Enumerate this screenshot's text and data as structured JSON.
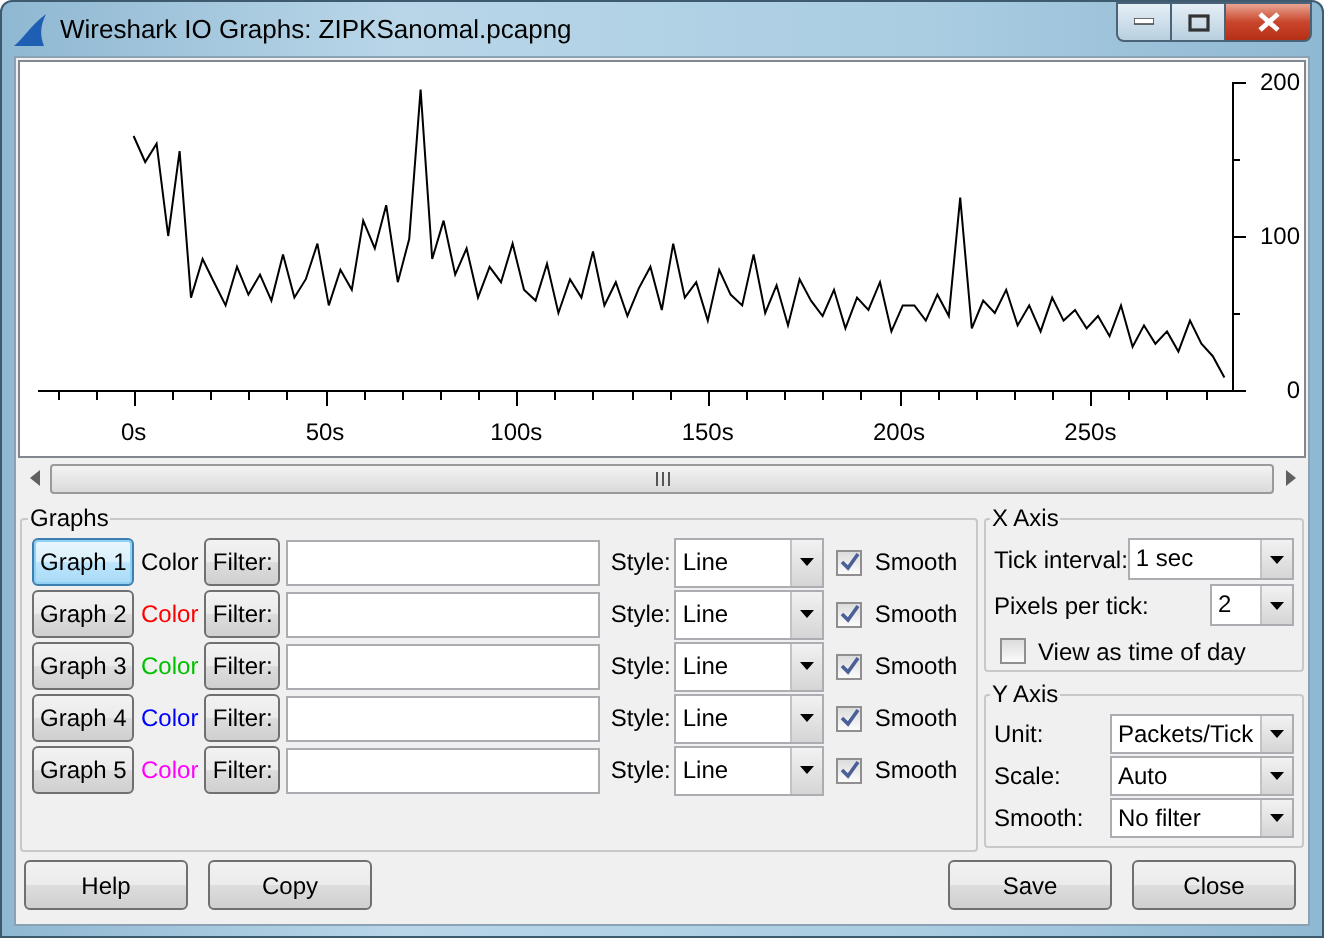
{
  "window": {
    "title": "Wireshark IO Graphs: ZIPKSanomal.pcapng"
  },
  "chart": {
    "chart_data": {
      "type": "line",
      "x": [
        0,
        3,
        6,
        9,
        12,
        15,
        18,
        21,
        24,
        27,
        30,
        33,
        36,
        39,
        42,
        45,
        48,
        51,
        54,
        57,
        60,
        63,
        66,
        69,
        72,
        75,
        78,
        81,
        84,
        87,
        90,
        93,
        96,
        99,
        102,
        105,
        108,
        111,
        114,
        117,
        120,
        123,
        126,
        129,
        132,
        135,
        138,
        141,
        144,
        147,
        150,
        153,
        156,
        159,
        162,
        165,
        168,
        171,
        174,
        177,
        180,
        183,
        186,
        189,
        192,
        195,
        198,
        201,
        204,
        207,
        210,
        213,
        216,
        219,
        222,
        225,
        228,
        231,
        234,
        237,
        240,
        243,
        246,
        249,
        252,
        255,
        258,
        261,
        264,
        267,
        270,
        273,
        276,
        279,
        282,
        285
      ],
      "xlim": [
        -25,
        287
      ],
      "ylim": [
        0,
        200
      ],
      "series": [
        {
          "color": "#000000",
          "values": [
            165,
            148,
            160,
            100,
            155,
            60,
            85,
            70,
            55,
            80,
            62,
            75,
            58,
            88,
            60,
            72,
            95,
            55,
            78,
            65,
            110,
            92,
            120,
            70,
            98,
            195,
            85,
            110,
            75,
            92,
            60,
            80,
            70,
            95,
            65,
            58,
            82,
            50,
            72,
            60,
            90,
            55,
            70,
            48,
            66,
            80,
            52,
            95,
            60,
            70,
            45,
            78,
            62,
            55,
            88,
            50,
            68,
            42,
            72,
            58,
            48,
            65,
            40,
            60,
            52,
            70,
            38,
            55,
            55,
            45,
            62,
            48,
            125,
            40,
            58,
            50,
            65,
            42,
            55,
            38,
            60,
            45,
            52,
            40,
            48,
            35,
            55,
            28,
            42,
            30,
            38,
            25,
            45,
            30,
            22,
            8
          ]
        }
      ],
      "xticks": [
        {
          "value": 0,
          "label": "0s"
        },
        {
          "value": 50,
          "label": "50s"
        },
        {
          "value": 100,
          "label": "100s"
        },
        {
          "value": 150,
          "label": "150s"
        },
        {
          "value": 200,
          "label": "200s"
        },
        {
          "value": 250,
          "label": "250s"
        }
      ],
      "yticks": [
        0,
        100,
        200
      ]
    }
  },
  "graphs": {
    "title": "Graphs",
    "rows": [
      {
        "button": "Graph 1",
        "selected": true,
        "color_label": "Color",
        "color": "#000000",
        "filter_button": "Filter:",
        "style_label": "Style:",
        "style": "Line",
        "smooth_label": "Smooth",
        "smooth": true
      },
      {
        "button": "Graph 2",
        "selected": false,
        "color_label": "Color",
        "color": "#ff0000",
        "filter_button": "Filter:",
        "style_label": "Style:",
        "style": "Line",
        "smooth_label": "Smooth",
        "smooth": true
      },
      {
        "button": "Graph 3",
        "selected": false,
        "color_label": "Color",
        "color": "#00c000",
        "filter_button": "Filter:",
        "style_label": "Style:",
        "style": "Line",
        "smooth_label": "Smooth",
        "smooth": true
      },
      {
        "button": "Graph 4",
        "selected": false,
        "color_label": "Color",
        "color": "#0000ff",
        "filter_button": "Filter:",
        "style_label": "Style:",
        "style": "Line",
        "smooth_label": "Smooth",
        "smooth": true
      },
      {
        "button": "Graph 5",
        "selected": false,
        "color_label": "Color",
        "color": "#ff00ff",
        "filter_button": "Filter:",
        "style_label": "Style:",
        "style": "Line",
        "smooth_label": "Smooth",
        "smooth": true
      }
    ]
  },
  "x_axis": {
    "title": "X Axis",
    "tick_interval_label": "Tick interval:",
    "tick_interval": "1 sec",
    "pixels_label": "Pixels per tick:",
    "pixels": "2",
    "time_of_day_label": "View as time of day",
    "time_of_day": false
  },
  "y_axis": {
    "title": "Y Axis",
    "fields": [
      {
        "label": "Unit:",
        "value": "Packets/Tick"
      },
      {
        "label": "Scale:",
        "value": "Auto"
      },
      {
        "label": "Smooth:",
        "value": "No filter"
      }
    ]
  },
  "left_buttons": [
    "Help",
    "Copy"
  ],
  "right_buttons": [
    "Save",
    "Close"
  ]
}
